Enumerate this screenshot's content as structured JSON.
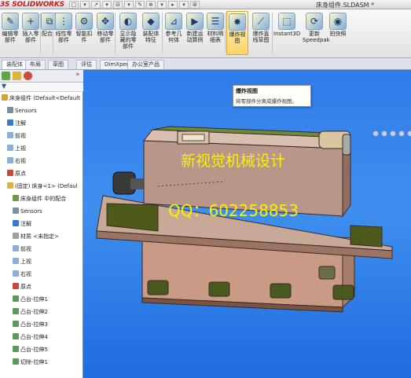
{
  "app": {
    "logo_text": "3S SOLIDWORKS",
    "doc_title": "床身组件.SLDASM *"
  },
  "quick_access": [
    "□",
    "▾",
    "↗",
    "▾",
    "⊟",
    "▾",
    "✎",
    "⊕",
    "▾",
    "▸",
    "▾",
    "⊞"
  ],
  "ribbon": {
    "buttons": [
      {
        "label": "编辑零\n部件",
        "icon": "edit-component-icon"
      },
      {
        "label": "插入零\n部件",
        "icon": "insert-component-icon"
      },
      {
        "label": "配合",
        "icon": "mate-icon"
      },
      {
        "label": "线性零\n部件",
        "icon": "linear-pattern-icon"
      },
      {
        "label": "智能扣\n件",
        "icon": "smart-fasteners-icon"
      },
      {
        "label": "移动零\n部件",
        "icon": "move-component-icon"
      },
      {
        "label": "显示隐\n藏的零\n部件",
        "icon": "show-hidden-icon"
      },
      {
        "label": "装配体\n特征",
        "icon": "assembly-features-icon"
      },
      {
        "label": "参考几\n何体",
        "icon": "reference-geometry-icon"
      },
      {
        "label": "新建运\n动算例",
        "icon": "motion-study-icon"
      },
      {
        "label": "材料明\n细表",
        "icon": "bom-icon"
      },
      {
        "label": "爆炸视\n图",
        "icon": "exploded-view-icon"
      },
      {
        "label": "爆炸直\n线草图",
        "icon": "explode-line-icon"
      },
      {
        "label": "Instant3D",
        "icon": "instant3d-icon"
      },
      {
        "label": "更新\nSpeedpak",
        "icon": "speedpak-icon"
      },
      {
        "label": "拍快照",
        "icon": "snapshot-icon"
      }
    ]
  },
  "tabs": [
    "装配体",
    "布局",
    "草图",
    "评估",
    "DimXpert",
    "办公室产品"
  ],
  "tooltip": {
    "title": "爆炸视图",
    "text": "将零部件分离成爆炸视图。"
  },
  "tree": [
    {
      "label": "床身组件 (Default<Default",
      "indent": 0,
      "icon": "assembly-icon"
    },
    {
      "label": "Sensors",
      "indent": 1,
      "icon": "sensors-icon"
    },
    {
      "label": "注解",
      "indent": 1,
      "icon": "annotations-icon"
    },
    {
      "label": "前视",
      "indent": 1,
      "icon": "plane-icon"
    },
    {
      "label": "上视",
      "indent": 1,
      "icon": "plane-icon"
    },
    {
      "label": "右视",
      "indent": 1,
      "icon": "plane-icon"
    },
    {
      "label": "原点",
      "indent": 1,
      "icon": "origin-icon"
    },
    {
      "label": "(固定) 床身<1> (Defaul",
      "indent": 1,
      "icon": "part-icon"
    },
    {
      "label": "床身组件 中的配合",
      "indent": 2,
      "icon": "mates-icon"
    },
    {
      "label": "Sensors",
      "indent": 2,
      "icon": "sensors-icon"
    },
    {
      "label": "注解",
      "indent": 2,
      "icon": "annotations-icon"
    },
    {
      "label": "材质 <未指定>",
      "indent": 2,
      "icon": "material-icon"
    },
    {
      "label": "前视",
      "indent": 2,
      "icon": "plane-icon"
    },
    {
      "label": "上视",
      "indent": 2,
      "icon": "plane-icon"
    },
    {
      "label": "右视",
      "indent": 2,
      "icon": "plane-icon"
    },
    {
      "label": "原点",
      "indent": 2,
      "icon": "origin-icon"
    },
    {
      "label": "凸台-拉伸1",
      "indent": 2,
      "icon": "feature-icon"
    },
    {
      "label": "凸台-拉伸2",
      "indent": 2,
      "icon": "feature-icon"
    },
    {
      "label": "凸台-拉伸3",
      "indent": 2,
      "icon": "feature-icon"
    },
    {
      "label": "凸台-拉伸4",
      "indent": 2,
      "icon": "feature-icon"
    },
    {
      "label": "凸台-拉伸5",
      "indent": 2,
      "icon": "feature-icon"
    },
    {
      "label": "切除-拉伸1",
      "indent": 2,
      "icon": "feature-icon"
    }
  ],
  "watermark": {
    "line1": "新视觉机械设计",
    "line2": "QQ：602258853"
  },
  "colors": {
    "viewport_bg": "#2f7bea",
    "watermark": "#f7f200",
    "machine_body": "#b89a8a",
    "machine_base": "#c79a88",
    "machine_dark": "#6e4a3c",
    "pit_color": "#4a5a1e"
  }
}
